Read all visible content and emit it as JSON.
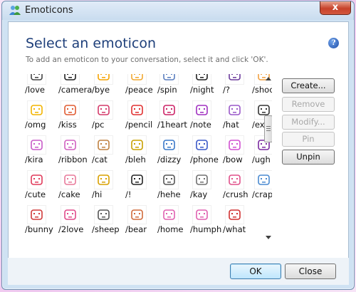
{
  "window": {
    "title": "Emoticons",
    "close_glyph": "x"
  },
  "dialog": {
    "heading": "Select an emoticon",
    "subtext": "To add an emoticon to your conversation, select it and click 'OK'.",
    "help_glyph": "?"
  },
  "emoticons": [
    [
      "/love",
      "/camera",
      "/bye",
      "/peace",
      "/spin",
      "/night",
      "/?",
      "/shock"
    ],
    [
      "/omg",
      "/kiss",
      "/pc",
      "/pencil",
      "/1heart",
      "/note",
      "/hat",
      "/excite"
    ],
    [
      "/kira",
      "/ribbon",
      "/cat",
      "/bleh",
      "/dizzy",
      "/phone",
      "/bow",
      "/ugh"
    ],
    [
      "/cute",
      "/cake",
      "/hi",
      "/!",
      "/hehe",
      "/kay",
      "/crush",
      "/crap"
    ],
    [
      "/bunny",
      "/2love",
      "/sheep",
      "/bear",
      "/home",
      "/humph",
      "/what"
    ]
  ],
  "emoticon_colors": [
    [
      "#444444",
      "#222222",
      "#f6a300",
      "#f1a830",
      "#5b7fbf",
      "#222222",
      "#6c3c9c",
      "#f2a040"
    ],
    [
      "#f2b400",
      "#e05a30",
      "#d43a6a",
      "#e03030",
      "#cc2266",
      "#a030c0",
      "#9a58c8",
      "#333333"
    ],
    [
      "#c85ac8",
      "#d060c0",
      "#c08040",
      "#c8a000",
      "#3a78c8",
      "#3a58c8",
      "#d050d0",
      "#7a2aa0"
    ],
    [
      "#e03a5a",
      "#e87a9a",
      "#d8a000",
      "#222222",
      "#555555",
      "#707070",
      "#e0508a",
      "#4a8ad0"
    ],
    [
      "#d03a3a",
      "#e04a8a",
      "#555555",
      "#d06a3a",
      "#e060b0",
      "#e060b0",
      "#d03030"
    ]
  ],
  "buttons": {
    "create": "Create...",
    "remove": "Remove",
    "modify": "Modify...",
    "pin": "Pin",
    "unpin": "Unpin",
    "ok": "OK",
    "close": "Close"
  }
}
